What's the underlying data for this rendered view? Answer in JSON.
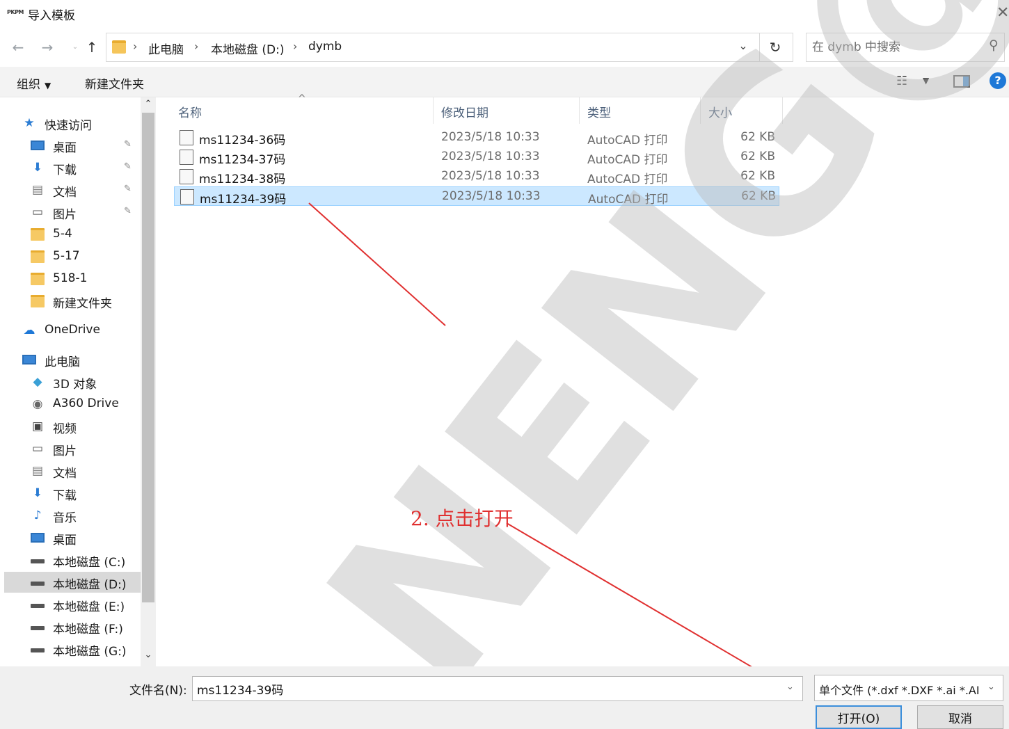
{
  "window": {
    "logo": "PKPM",
    "title": "导入模板",
    "close": "✕"
  },
  "nav": {
    "back": "←",
    "forward": "→",
    "recent": "⌄",
    "up": "↑",
    "breadcrumbs": [
      "此电脑",
      "本地磁盘 (D:)",
      "dymb"
    ],
    "breadcrumb_sep": "›",
    "dropdown": "⌄",
    "refresh": "↻",
    "search_placeholder": "在 dymb 中搜索",
    "search_icon": "⚲"
  },
  "commands": {
    "organize": "组织",
    "organize_caret": "▼",
    "new_folder": "新建文件夹",
    "view_icon": "☷",
    "view_caret": "▼",
    "help": "?"
  },
  "sidebar": {
    "items": [
      {
        "label": "快速访问",
        "icon": "★",
        "icon_name": "star-icon",
        "color": "#2b7cd3",
        "pinned": false
      },
      {
        "label": "桌面",
        "icon": "",
        "icon_name": "desktop-icon",
        "color": "#3a86d6",
        "pinned": true
      },
      {
        "label": "下载",
        "icon": "⬇",
        "icon_name": "download-icon",
        "color": "#2b7cd3",
        "pinned": true
      },
      {
        "label": "文档",
        "icon": "▤",
        "icon_name": "document-icon",
        "color": "#777777",
        "pinned": true
      },
      {
        "label": "图片",
        "icon": "▭",
        "icon_name": "pictures-icon",
        "color": "#555555",
        "pinned": true
      },
      {
        "label": "5-4",
        "icon": "",
        "icon_name": "folder-icon",
        "color": "#f6c964",
        "pinned": false
      },
      {
        "label": "5-17",
        "icon": "",
        "icon_name": "folder-icon",
        "color": "#f6c964",
        "pinned": false
      },
      {
        "label": "518-1",
        "icon": "",
        "icon_name": "folder-icon",
        "color": "#f6c964",
        "pinned": false
      },
      {
        "label": "新建文件夹",
        "icon": "",
        "icon_name": "folder-icon",
        "color": "#f6c964",
        "pinned": false
      },
      {
        "label": "OneDrive",
        "icon": "☁",
        "icon_name": "cloud-icon",
        "color": "#1e78d7",
        "pinned": false
      },
      {
        "label": "此电脑",
        "icon": "",
        "icon_name": "computer-icon",
        "color": "#3a86d6",
        "pinned": false
      },
      {
        "label": "3D 对象",
        "icon": "◆",
        "icon_name": "cube-icon",
        "color": "#3aa0d6",
        "pinned": false
      },
      {
        "label": "A360 Drive",
        "icon": "◉",
        "icon_name": "a360-drive-icon",
        "color": "#666666",
        "pinned": false
      },
      {
        "label": "视频",
        "icon": "▣",
        "icon_name": "video-icon",
        "color": "#444444",
        "pinned": false
      },
      {
        "label": "图片",
        "icon": "▭",
        "icon_name": "pictures-icon",
        "color": "#555555",
        "pinned": false
      },
      {
        "label": "文档",
        "icon": "▤",
        "icon_name": "document-icon",
        "color": "#777777",
        "pinned": false
      },
      {
        "label": "下载",
        "icon": "⬇",
        "icon_name": "download-icon",
        "color": "#2b7cd3",
        "pinned": false
      },
      {
        "label": "音乐",
        "icon": "♪",
        "icon_name": "music-icon",
        "color": "#2b7cd3",
        "pinned": false
      },
      {
        "label": "桌面",
        "icon": "",
        "icon_name": "desktop-icon",
        "color": "#3a86d6",
        "pinned": false
      },
      {
        "label": "本地磁盘 (C:)",
        "icon": "",
        "icon_name": "drive-icon",
        "color": "#555555",
        "pinned": false
      },
      {
        "label": "本地磁盘 (D:)",
        "icon": "",
        "icon_name": "drive-icon",
        "color": "#555555",
        "pinned": false,
        "selected": true
      },
      {
        "label": "本地磁盘 (E:)",
        "icon": "",
        "icon_name": "drive-icon",
        "color": "#555555",
        "pinned": false
      },
      {
        "label": "本地磁盘 (F:)",
        "icon": "",
        "icon_name": "drive-icon",
        "color": "#555555",
        "pinned": false
      },
      {
        "label": "本地磁盘 (G:)",
        "icon": "",
        "icon_name": "drive-icon",
        "color": "#555555",
        "pinned": false
      }
    ],
    "pin_glyph": "✎",
    "scroll_up": "⌃",
    "scroll_down": "⌄"
  },
  "columns": {
    "name": "名称",
    "date": "修改日期",
    "type": "类型",
    "size": "大小",
    "sort_glyph": "^"
  },
  "files": [
    {
      "name": "ms11234-36码",
      "date": "2023/5/18 10:33",
      "type": "AutoCAD 打印",
      "size": "62 KB",
      "selected": false
    },
    {
      "name": "ms11234-37码",
      "date": "2023/5/18 10:33",
      "type": "AutoCAD 打印",
      "size": "62 KB",
      "selected": false
    },
    {
      "name": "ms11234-38码",
      "date": "2023/5/18 10:33",
      "type": "AutoCAD 打印",
      "size": "62 KB",
      "selected": false
    },
    {
      "name": "ms11234-39码",
      "date": "2023/5/18 10:33",
      "type": "AutoCAD 打印",
      "size": "62 KB",
      "selected": true
    }
  ],
  "bottom": {
    "filename_label": "文件名(N):",
    "filename_value": "ms11234-39码",
    "filename_dropdown": "⌄",
    "filter": "单个文件 (*.dxf *.DXF *.ai *.AI",
    "filter_caret": "⌄",
    "open_label": "打开(O)",
    "cancel_label": "取消"
  },
  "annotation": {
    "text": "2. 点击打开",
    "color": "#e03030"
  },
  "watermark": {
    "text": "NENG@",
    "color": "#bbbbbb"
  }
}
